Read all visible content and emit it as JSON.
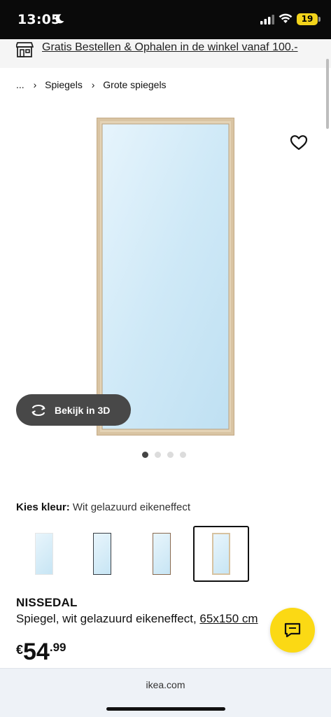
{
  "status_bar": {
    "time": "13:05",
    "battery": "19",
    "icons": [
      "moon-icon",
      "signal-icon",
      "wifi-icon",
      "battery-icon"
    ]
  },
  "promo": {
    "text": "Gratis Bestellen & Ophalen in de winkel vanaf 100.-",
    "icon": "store-icon"
  },
  "breadcrumb": {
    "ellipsis": "...",
    "separator": "›",
    "items": [
      "Spiegels",
      "Grote spiegels"
    ]
  },
  "gallery": {
    "view_3d_label": "Bekijk in 3D",
    "dot_count": 4,
    "active_dot": 0,
    "frame_color": "#d9c4a3",
    "glass_color": "#cfe9f7"
  },
  "color_picker": {
    "label": "Kies kleur:",
    "value": "Wit gelazuurd eikeneffect",
    "swatches": [
      {
        "frame": "#e6e6e6",
        "selected": false
      },
      {
        "frame": "#3a3f45",
        "selected": false
      },
      {
        "frame": "#8a6a4f",
        "selected": false
      },
      {
        "frame": "#d7c2a0",
        "selected": true
      }
    ]
  },
  "product": {
    "name": "NISSEDAL",
    "description_prefix": "Spiegel, wit gelazuurd eikeneffect, ",
    "description_dims": "65x150 cm"
  },
  "price": {
    "currency": "€",
    "integer": "54",
    "decimals": ".99"
  },
  "chat": {
    "icon": "chat-icon",
    "accent": "#fbd914"
  },
  "browser": {
    "url": "ikea.com"
  }
}
